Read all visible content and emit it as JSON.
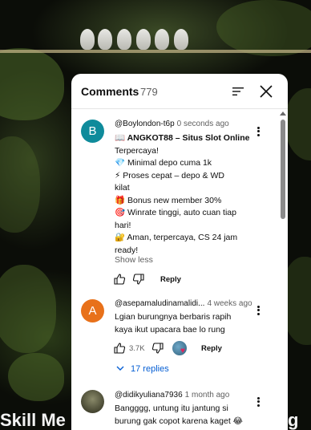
{
  "video": {
    "caption_left": "Skill Me",
    "caption_right": "g"
  },
  "panel": {
    "title": "Comments",
    "count": "779",
    "icons": {
      "sort": "sort-icon",
      "close": "close-icon"
    }
  },
  "comments": [
    {
      "avatar_letter": "B",
      "avatar_color": "#0f8b9b",
      "author": "@Boylondon-t6p",
      "timestamp": "0 seconds ago",
      "lines": [
        "📖 ANGKOT88 – Situs Slot Online",
        "Terpercaya!",
        "💎 Minimal depo cuma 1k",
        "⚡ Proses cepat – depo & WD",
        "kilat",
        "🎁 Bonus new member 30%",
        "🎯 Winrate tinggi, auto cuan tiap",
        "hari!",
        "🔐 Aman, terpercaya, CS 24 jam",
        "ready!"
      ],
      "show_less": "Show less",
      "reply_label": "Reply"
    },
    {
      "avatar_letter": "A",
      "avatar_color": "#e8711a",
      "author": "@asepamaludinamalidi...",
      "timestamp": "4 weeks ago",
      "lines": [
        "Lgian burungnya berbaris rapih",
        "kaya ikut upacara bae lo rung"
      ],
      "like_count": "3.7K",
      "reply_label": "Reply",
      "replies_label": "17 replies"
    },
    {
      "avatar_color": "#3a3a2a",
      "author": "@didikyuliana7936",
      "timestamp": "1 month ago",
      "lines": [
        "Bangggg, untung itu jantung si",
        "burung gak copot karena kaget 😂"
      ]
    }
  ]
}
